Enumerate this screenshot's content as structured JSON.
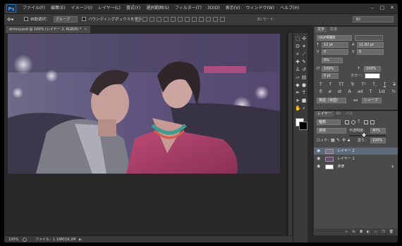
{
  "app": {
    "logo": "Ps"
  },
  "menu": [
    "ファイル(F)",
    "編集(E)",
    "イメージ(I)",
    "レイヤー(L)",
    "書式(Y)",
    "選択範囲(S)",
    "フィルター(T)",
    "3D(D)",
    "表示(V)",
    "ウィンドウ(W)",
    "ヘルプ(H)"
  ],
  "window_controls": {
    "minimize": "–",
    "maximize": "□",
    "close": "✕"
  },
  "options": {
    "tool_icon": "move-tool-icon",
    "auto_select_label": "自動選択：",
    "auto_select_value": "グループ",
    "transform_label": "バウンディングボックスを表示",
    "mode_3d": "3D モード：",
    "workspace": "3D"
  },
  "document": {
    "tab_title": "dntosy.psd @ 100% (レイヤー 2, RGB/8) *",
    "close": "×"
  },
  "status": {
    "zoom": "100%",
    "file_info": "ファイル：1.18M/16.2M",
    "arrow": "▶"
  },
  "char_panel": {
    "tabs": [
      "文字",
      "段落"
    ],
    "font_family": "HGP明朝E",
    "font_style": "-",
    "size": "12 pt",
    "leading": "11.82 pt",
    "kerning": "0",
    "tracking": "0",
    "vscale": "100%",
    "hscale": "100%",
    "baseline": "0 pt",
    "color_label": "カラー：",
    "tsume": "0%",
    "style_glyphs": [
      "T",
      "T",
      "TT",
      "Tr",
      "T¹",
      "T,",
      "T",
      "T"
    ],
    "ot_glyphs": [
      "fi",
      "ø",
      "st",
      "A",
      "ad",
      "T",
      "1st",
      "½"
    ],
    "language": "英語（米国）",
    "aa_label": "aa",
    "antialias": "シャープ"
  },
  "layers_panel": {
    "tabs": [
      "レイヤー",
      "3D",
      "パス"
    ],
    "kind_label": "種類",
    "blend_mode": "通常",
    "opacity_label": "不透明度：",
    "opacity": "40%",
    "lock_label": "ロック：",
    "fill_label": "塗り：",
    "fill": "100%",
    "layers": [
      {
        "name": "レイヤー 2",
        "selected": true
      },
      {
        "name": "レイヤー 1",
        "selected": false
      },
      {
        "name": "背景",
        "selected": false
      }
    ]
  },
  "colors": {
    "accent": "#4aa3ff",
    "selected_row": "#5c6a7c",
    "panel": "#4a4a4a"
  }
}
